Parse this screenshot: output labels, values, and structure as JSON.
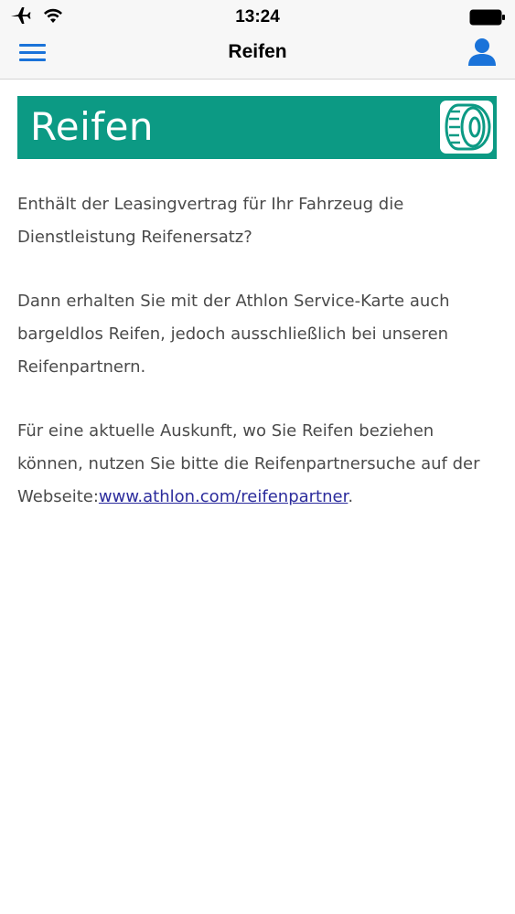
{
  "status_bar": {
    "time": "13:24",
    "airplane_icon": "airplane-icon",
    "wifi_icon": "wifi-icon",
    "battery_icon": "battery-icon"
  },
  "nav": {
    "title": "Reifen",
    "menu_icon": "hamburger-menu-icon",
    "user_icon": "user-profile-icon",
    "accent_color": "#1a73d9"
  },
  "banner": {
    "title": "Reifen",
    "background_color": "#0c9a84",
    "icon": "tire-icon"
  },
  "content": {
    "paragraph1": "Enthält der Leasingvertrag für Ihr Fahrzeug die Dienstleistung Reifenersatz?",
    "paragraph2": "Dann erhalten Sie mit der Athlon Service-Karte auch bargeldlos Reifen, jedoch ausschließlich bei unseren Reifenpartnern.",
    "paragraph3_prefix": "Für eine aktuelle Auskunft, wo Sie Reifen beziehen können, nutzen Sie bitte die Reifenpartnersuche auf der Webseite:",
    "paragraph3_link": "www.athlon.com/reifenpartner",
    "paragraph3_suffix": "."
  }
}
